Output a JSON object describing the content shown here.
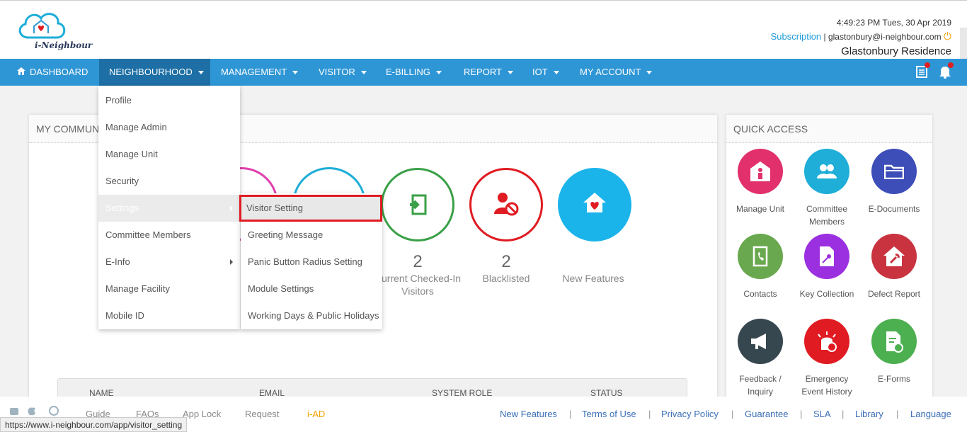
{
  "header": {
    "logo_text": "i-Neighbour",
    "datetime": "4:49:23 PM  Tues, 30 Apr 2019",
    "subscription": "Subscription",
    "separator": " | ",
    "email": "glastonbury@i-neighbour.com",
    "residence": "Glastonbury Residence"
  },
  "nav": {
    "items": [
      {
        "label": "DASHBOARD"
      },
      {
        "label": "NEIGHBOURHOOD"
      },
      {
        "label": "MANAGEMENT"
      },
      {
        "label": "VISITOR"
      },
      {
        "label": "E-BILLING"
      },
      {
        "label": "REPORT"
      },
      {
        "label": "IOT"
      },
      {
        "label": "MY ACCOUNT"
      }
    ],
    "icons": [
      "home-icon",
      "notes-icon",
      "bell-icon"
    ],
    "accent": "#2f96d6"
  },
  "dropdown": {
    "items": [
      "Profile",
      "Manage Admin",
      "Manage Unit",
      "Security",
      "Settings",
      "Committee Members",
      "E-Info",
      "Manage Facility",
      "Mobile ID"
    ]
  },
  "submenu": {
    "items": [
      "Visitor Setting",
      "Greeting Message",
      "Panic Button Radius Setting",
      "Module Settings",
      "Working Days & Public Holidays"
    ],
    "selected": "Visitor Setting"
  },
  "community": {
    "title": "MY COMMUNITY",
    "visible_title": "MY COMMUNI",
    "stats": [
      {
        "value": "2",
        "label": "Current Checked-In Visitors",
        "color": "#3aa047"
      },
      {
        "value": "2",
        "label": "Blacklisted",
        "color": "#e01b22"
      },
      {
        "value": "",
        "label": "New Features",
        "color": "#1ab4ea"
      }
    ],
    "table_headers": [
      "NAME",
      "EMAIL",
      "SYSTEM ROLE",
      "STATUS"
    ]
  },
  "quick_access": {
    "title": "QUICK ACCESS",
    "items": [
      {
        "label": "Manage Unit",
        "color": "#e1306c",
        "icon": "building-icon"
      },
      {
        "label": "Committee Members",
        "color": "#1eaed8",
        "icon": "users-icon"
      },
      {
        "label": "E-Documents",
        "color": "#3d4eb8",
        "icon": "folder-icon"
      },
      {
        "label": "Contacts",
        "color": "#6aa84f",
        "icon": "phone-book-icon"
      },
      {
        "label": "Key Collection",
        "color": "#9b30e0",
        "icon": "key-doc-icon"
      },
      {
        "label": "Defect Report",
        "color": "#c8333f",
        "icon": "house-tool-icon"
      },
      {
        "label": "Feedback / Inquiry",
        "color": "#37474f",
        "icon": "megaphone-icon"
      },
      {
        "label": "Emergency Event History",
        "color": "#e01b22",
        "icon": "alarm-icon"
      },
      {
        "label": "E-Forms",
        "color": "#4caf50",
        "icon": "form-icon"
      }
    ]
  },
  "footer": {
    "left_links": [
      "Guide",
      "FAQs",
      "App Lock",
      "Request",
      "i-AD"
    ],
    "links": [
      "New Features",
      "Terms of Use",
      "Privacy Policy",
      "Guarantee",
      "SLA",
      "Library",
      "Language"
    ]
  },
  "status_url": "https://www.i-neighbour.com/app/visitor_setting"
}
